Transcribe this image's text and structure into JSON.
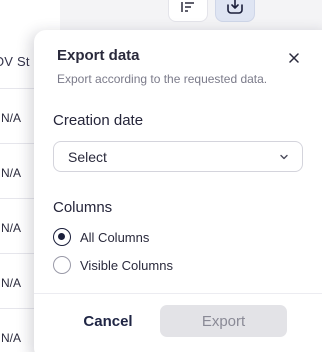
{
  "background_table": {
    "column_header": "OV St",
    "cells": [
      "N/A",
      "N/A",
      "N/A",
      "N/A",
      "N/A"
    ]
  },
  "toolbar": {
    "sort_icon": "sort-lines-icon",
    "export_icon": "export-download-icon"
  },
  "dialog": {
    "title": "Export data",
    "subtitle": "Export according to the requested data.",
    "close_icon": "close-icon",
    "creation_date": {
      "label": "Creation date",
      "value": "Select",
      "icon": "chevron-down-icon"
    },
    "columns": {
      "label": "Columns",
      "options": [
        {
          "label": "All Columns",
          "checked": true
        },
        {
          "label": "Visible Columns",
          "checked": false
        }
      ]
    },
    "cancel_label": "Cancel",
    "export_label": "Export"
  },
  "colors": {
    "accent": "#1b1f3b",
    "export_active_bg": "#dfe5f3",
    "disabled_bg": "#e3e3e7"
  }
}
